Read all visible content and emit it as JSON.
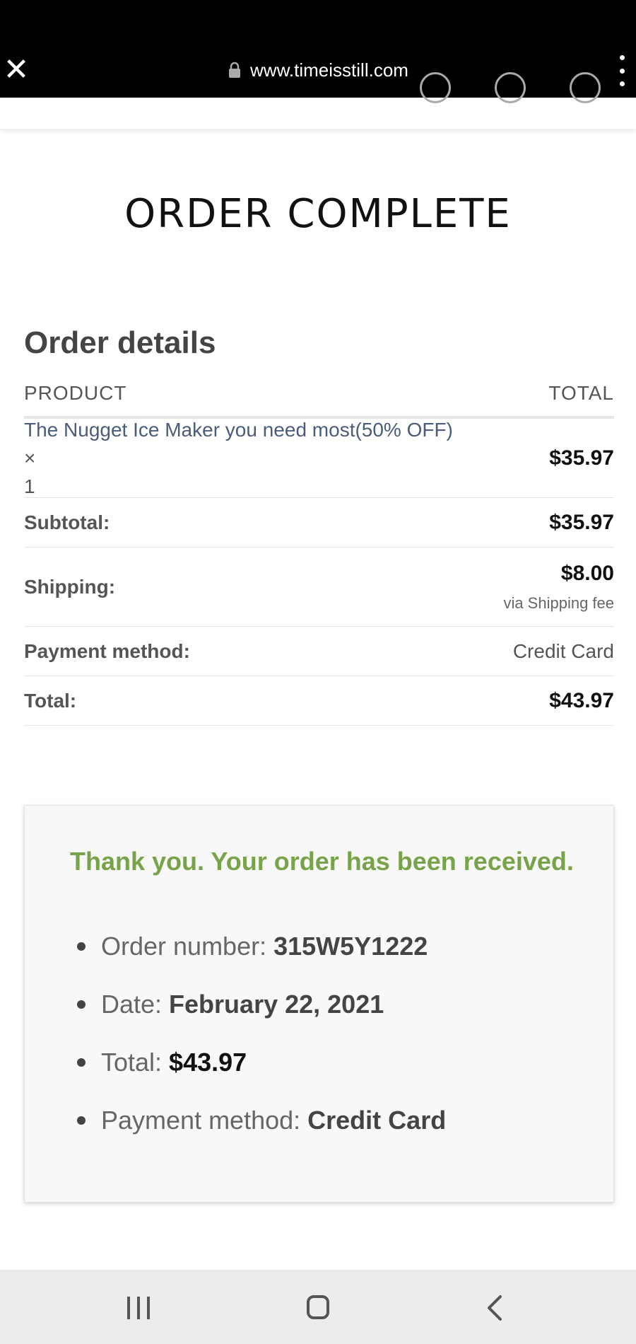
{
  "browser": {
    "url": "www.timeisstill.com",
    "close_icon": "close-icon",
    "menu_icon": "more-vert-icon"
  },
  "page": {
    "title": "ORDER COMPLETE",
    "section_title": "Order details"
  },
  "order_table": {
    "headers": {
      "product": "PRODUCT",
      "total": "TOTAL"
    },
    "product": {
      "name": "The Nugget Ice Maker you need most(50% OFF)",
      "times": "×",
      "quantity": "1",
      "amount": "$35.97"
    },
    "subtotal": {
      "label": "Subtotal:",
      "value": "$35.97"
    },
    "shipping": {
      "label": "Shipping:",
      "value": "$8.00",
      "via": "via Shipping fee"
    },
    "payment": {
      "label": "Payment method:",
      "value": "Credit Card"
    },
    "total": {
      "label": "Total:",
      "value": "$43.97"
    }
  },
  "received": {
    "message": "Thank you. Your order has been received.",
    "accent_color": "#78a34a",
    "items": [
      {
        "label": "Order number:",
        "value": "315W5Y1222"
      },
      {
        "label": "Date:",
        "value": "February 22, 2021"
      },
      {
        "label": "Total:",
        "value": "$43.97"
      },
      {
        "label": "Payment method:",
        "value": "Credit Card"
      }
    ]
  },
  "nav": {
    "recents_icon": "recent-apps-icon",
    "home_icon": "home-icon",
    "back_icon": "back-icon"
  }
}
